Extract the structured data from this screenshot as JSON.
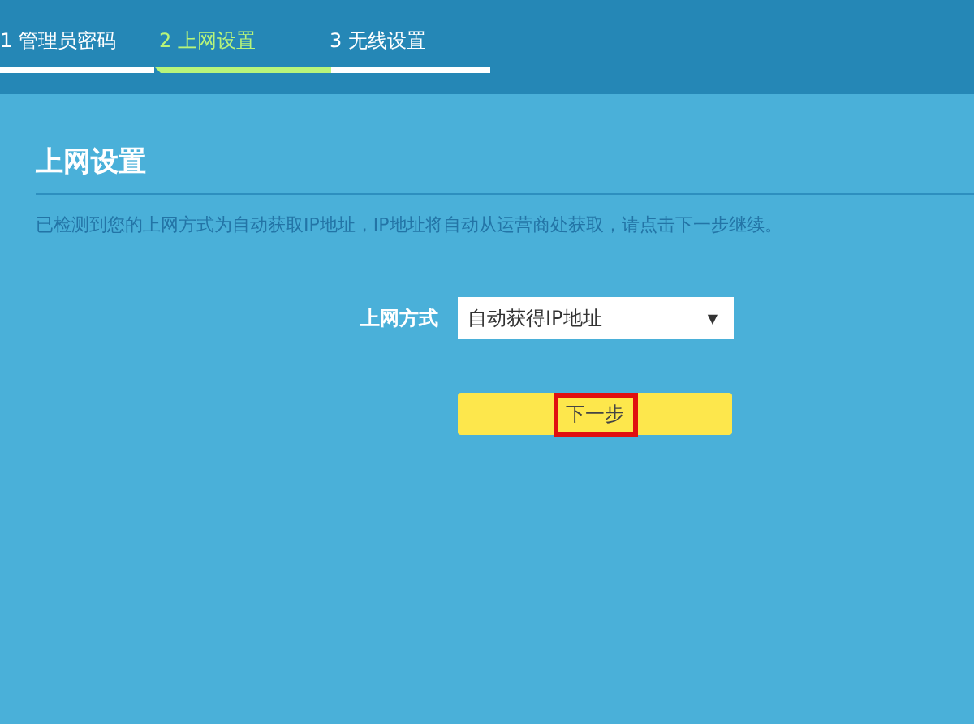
{
  "steps": [
    {
      "label": "1 管理员密码",
      "selected": false
    },
    {
      "label": "2 上网设置",
      "selected": true
    },
    {
      "label": "3 无线设置",
      "selected": false
    }
  ],
  "section": {
    "title": "上网设置",
    "description": "已检测到您的上网方式为自动获取IP地址，IP地址将自动从运营商处获取，请点击下一步继续。"
  },
  "form": {
    "label": "上网方式",
    "value": "自动获得IP地址",
    "arrow": "▼"
  },
  "next_button": {
    "label": "下一步",
    "highlighted": true
  }
}
